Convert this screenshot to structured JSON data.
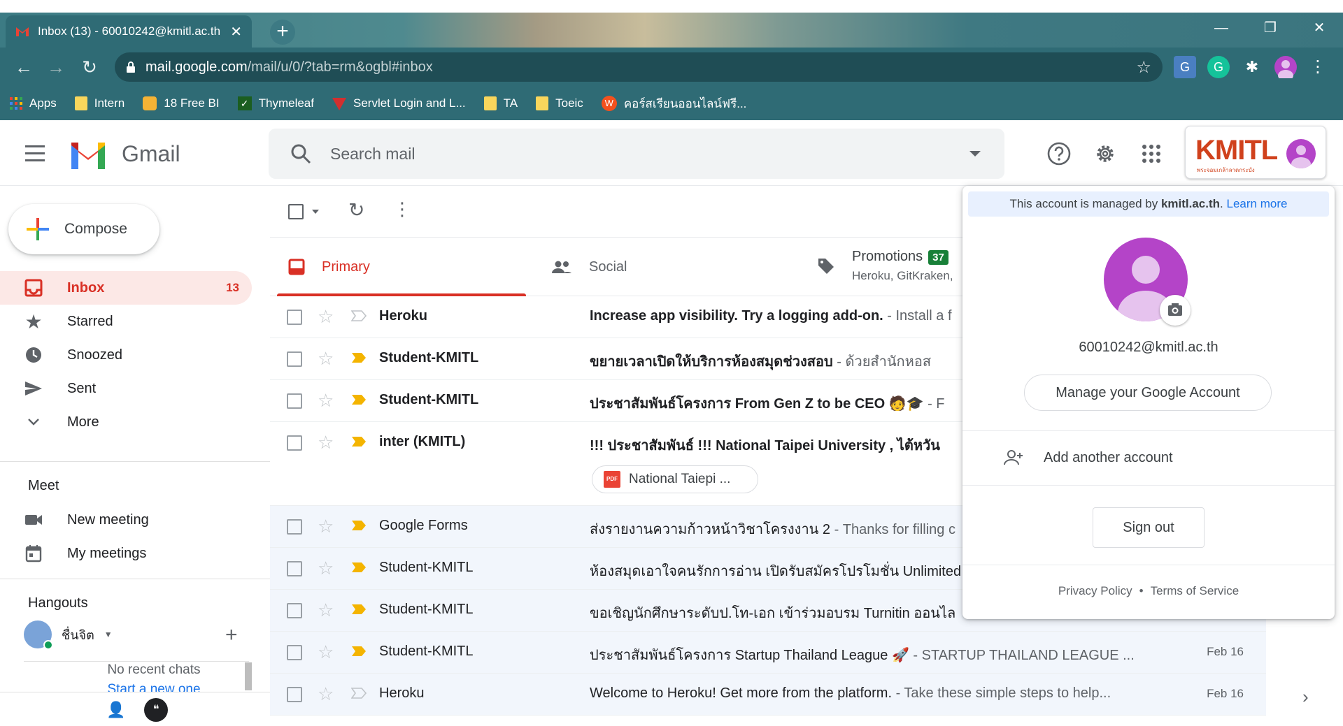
{
  "browser": {
    "tab_title": "Inbox (13) - 60010242@kmitl.ac.th",
    "url_host": "mail.google.com",
    "url_path": "/mail/u/0/?tab=rm&ogbl#inbox",
    "bookmarks": [
      {
        "label": "Apps",
        "icon": "apps-grid-icon"
      },
      {
        "label": "Intern",
        "icon": "folder-icon"
      },
      {
        "label": "18 Free BI",
        "icon": "bookmark-site-icon"
      },
      {
        "label": "Thymeleaf",
        "icon": "thymeleaf-icon"
      },
      {
        "label": "Servlet Login and L...",
        "icon": "servlet-icon"
      },
      {
        "label": "TA",
        "icon": "folder-icon"
      },
      {
        "label": "Toeic",
        "icon": "folder-icon"
      },
      {
        "label": "คอร์สเรียนออนไลน์ฟรี...",
        "icon": "w-site-icon"
      }
    ]
  },
  "header": {
    "product": "Gmail",
    "search_placeholder": "Search mail",
    "org_logo": "KMITL",
    "org_logo_sub": "พระจอมเกล้าลาดกระบัง"
  },
  "sidebar": {
    "compose": "Compose",
    "items": [
      {
        "label": "Inbox",
        "count": "13",
        "icon": "inbox-icon"
      },
      {
        "label": "Starred",
        "count": "",
        "icon": "star-icon"
      },
      {
        "label": "Snoozed",
        "count": "",
        "icon": "clock-icon"
      },
      {
        "label": "Sent",
        "count": "",
        "icon": "send-icon"
      },
      {
        "label": "More",
        "count": "",
        "icon": "chevron-down-icon"
      }
    ],
    "meet_title": "Meet",
    "meet_items": [
      {
        "label": "New meeting",
        "icon": "video-icon"
      },
      {
        "label": "My meetings",
        "icon": "calendar-icon"
      }
    ],
    "hangouts_title": "Hangouts",
    "hangouts_user": "ชื่นจิต",
    "no_chats": "No recent chats",
    "start_new": "Start a new one"
  },
  "tabs": {
    "primary": "Primary",
    "social": "Social",
    "promotions": "Promotions",
    "promotions_count": "37",
    "promotions_snippet": "Heroku, GitKraken,"
  },
  "emails": [
    {
      "sender": "Heroku",
      "subject": "Increase app visibility. Try a logging add-on.",
      "snippet": " - Install a f",
      "date": "",
      "unread": true,
      "important": false
    },
    {
      "sender": "Student-KMITL",
      "subject": "ขยายเวลาเปิดให้บริการห้องสมุดช่วงสอบ",
      "snippet": " - ด้วยสำนักหอส",
      "date": "",
      "unread": true,
      "important": true
    },
    {
      "sender": "Student-KMITL",
      "subject": "ประชาสัมพันธ์โครงการ From Gen Z to be CEO 🧑🎓",
      "snippet": " - F",
      "date": "",
      "unread": true,
      "important": true
    },
    {
      "sender": "inter (KMITL)",
      "subject": "!!! ประชาสัมพันธ์ !!! National Taipei University , ไต้หวัน ",
      "snippet": "",
      "date": "",
      "unread": true,
      "important": true,
      "attachment": "National Taiepi ..."
    },
    {
      "sender": "Google Forms",
      "subject": "ส่งรายงานความก้าวหน้าวิชาโครงงาน 2",
      "snippet": " - Thanks for filling c",
      "date": "",
      "unread": false,
      "important": true
    },
    {
      "sender": "Student-KMITL",
      "subject": "ห้องสมุดเอาใจคนรักการอ่าน เปิดรับสมัครโปรโมชั่น Unlimited",
      "snippet": "",
      "date": "",
      "unread": false,
      "important": true
    },
    {
      "sender": "Student-KMITL",
      "subject": "ขอเชิญนักศึกษาระดับป.โท-เอก เข้าร่วมอบรม Turnitin ออนไล",
      "snippet": "",
      "date": "",
      "unread": false,
      "important": true
    },
    {
      "sender": "Student-KMITL",
      "subject": "ประชาสัมพันธ์โครงการ Startup Thailand League 🚀",
      "snippet": " - STARTUP THAILAND LEAGUE ...",
      "date": "Feb 16",
      "unread": false,
      "important": true
    },
    {
      "sender": "Heroku",
      "subject": "Welcome to Heroku! Get more from the platform.",
      "snippet": " - Take these simple steps to help...",
      "date": "Feb 16",
      "unread": false,
      "important": false
    }
  ],
  "account_panel": {
    "managed_prefix": "This account is managed by ",
    "managed_domain": "kmitl.ac.th",
    "managed_suffix": ". ",
    "learn_more": "Learn more",
    "email": "60010242@kmitl.ac.th",
    "manage": "Manage your Google Account",
    "add_account": "Add another account",
    "sign_out": "Sign out",
    "privacy": "Privacy Policy",
    "dot": "•",
    "terms": "Terms of Service"
  },
  "colors": {
    "accent_red": "#d93025",
    "chrome_teal": "#2f6b75",
    "avatar_purple": "#b444c8",
    "link_blue": "#1a73e8"
  }
}
